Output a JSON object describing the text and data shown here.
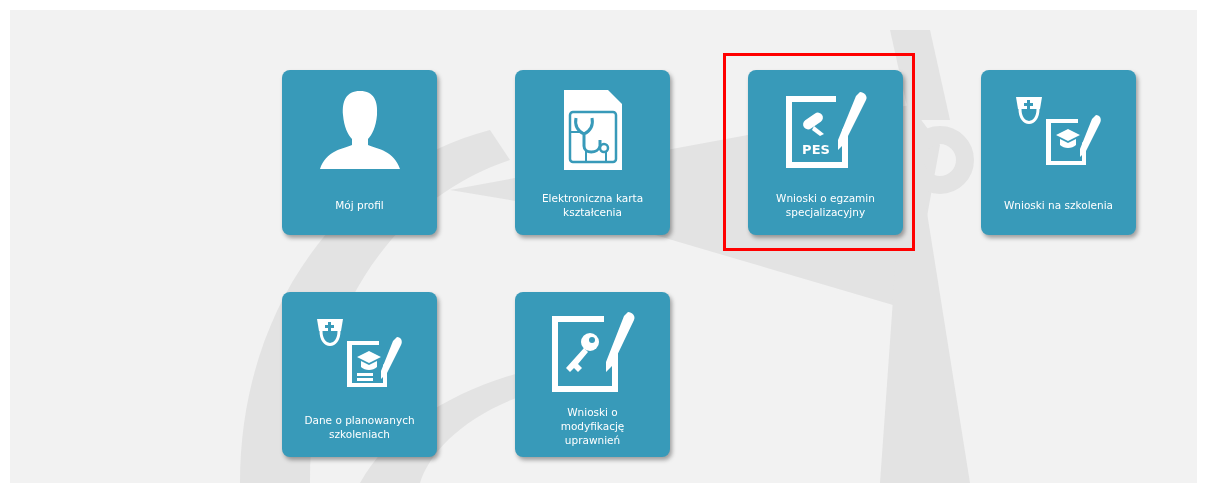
{
  "tiles": [
    {
      "label": "Mój profil",
      "kind": "person",
      "highlighted": false
    },
    {
      "label": "Elektroniczna karta kształcenia",
      "kind": "sim-card",
      "highlighted": false
    },
    {
      "label": "Wnioski o egzamin specjalizacyjny",
      "kind": "certificate",
      "icon_label": "PES",
      "highlighted": true
    },
    {
      "label": "Wnioski na szkolenia",
      "kind": "nurse-document",
      "highlighted": false
    },
    {
      "label": "Dane o planowanych szkoleniach",
      "kind": "nurse-form",
      "highlighted": false
    },
    {
      "label": "Wnioski o modyfikację uprawnień",
      "kind": "key-document",
      "highlighted": false
    }
  ]
}
